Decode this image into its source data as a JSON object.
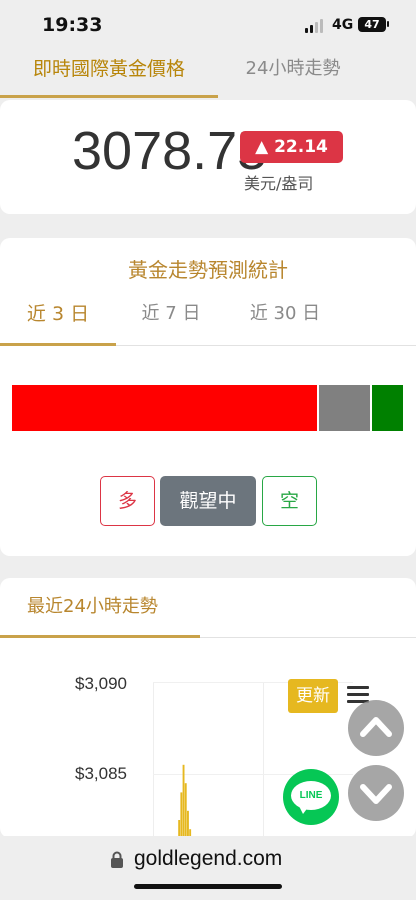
{
  "status_bar": {
    "time": "19:33",
    "network": "4G",
    "battery": "47"
  },
  "top_tabs": {
    "active": "即時國際黃金價格",
    "inactive": "24小時走勢"
  },
  "price": {
    "value": "3078.75",
    "change": "▲ 22.14",
    "unit": "美元/盎司",
    "change_color": "#dc3545"
  },
  "forecast": {
    "title": "黃金走勢預測統計",
    "tabs": [
      "近 3 日",
      "近 7 日",
      "近 30 日"
    ],
    "ratio": {
      "bullish": 0.78,
      "neutral": 0.13,
      "bearish": 0.09,
      "colors": {
        "bullish": "#ff0000",
        "neutral": "#808080",
        "bearish": "#008000"
      }
    },
    "buttons": {
      "long": "多",
      "wait": "觀望中",
      "short": "空"
    }
  },
  "trend": {
    "title": "最近24小時走勢",
    "y_ticks": [
      "$3,090",
      "$3,085"
    ],
    "refresh_label": "更新"
  },
  "float": {
    "up_icon": "chevron-up-icon",
    "down_icon": "chevron-down-icon",
    "line_label": "LINE"
  },
  "url_bar": {
    "domain": "goldlegend.com"
  },
  "chart_data": {
    "type": "bar",
    "title": "",
    "xlabel": "",
    "ylabel": "",
    "ylim": [
      3080,
      3090
    ],
    "y_ticks": [
      "$3,090",
      "$3,085"
    ],
    "color": "#e6b820",
    "values": [
      3081.5,
      3082.5,
      3084,
      3085.5,
      3084.5,
      3083,
      3082,
      3081
    ]
  }
}
